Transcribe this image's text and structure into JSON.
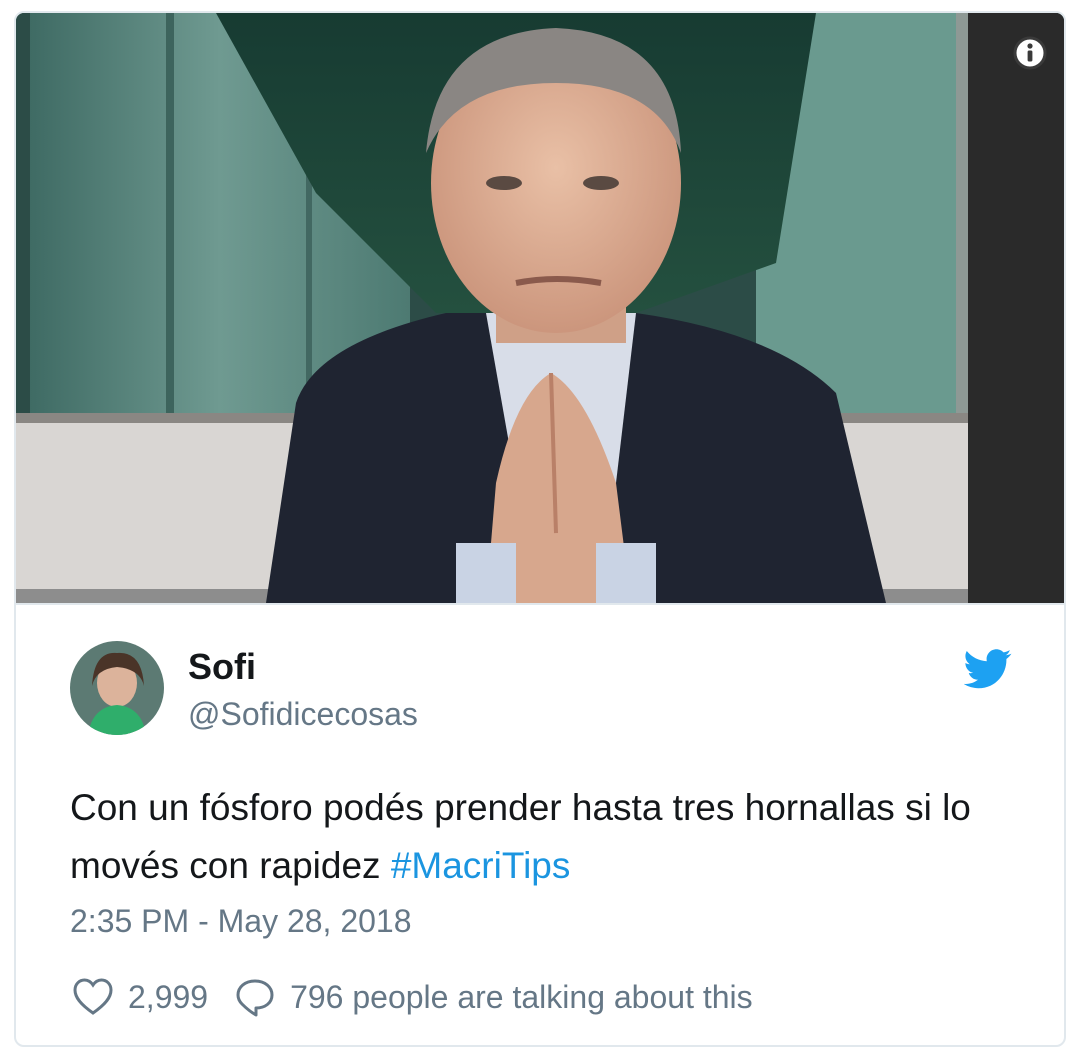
{
  "embed": {
    "media": {
      "alt": "",
      "info_icon": "info-icon"
    },
    "author": {
      "name": "Sofi",
      "handle": "@Sofidicecosas",
      "avatar_icon": "avatar"
    },
    "brand_icon": "twitter-bird-icon",
    "brand_color": "#1da1f2",
    "text": {
      "body": "Con un fósforo podés prender hasta tres hornallas si lo movés con rapidez",
      "hashtag": "#MacriTips",
      "hashtag_color": "#1b95e0"
    },
    "timestamp": "2:35 PM - May 28, 2018",
    "stats": {
      "like_icon": "heart-icon",
      "likes": "2,999",
      "reply_icon": "speech-bubble-icon",
      "talking": "796 people are talking about this"
    }
  }
}
